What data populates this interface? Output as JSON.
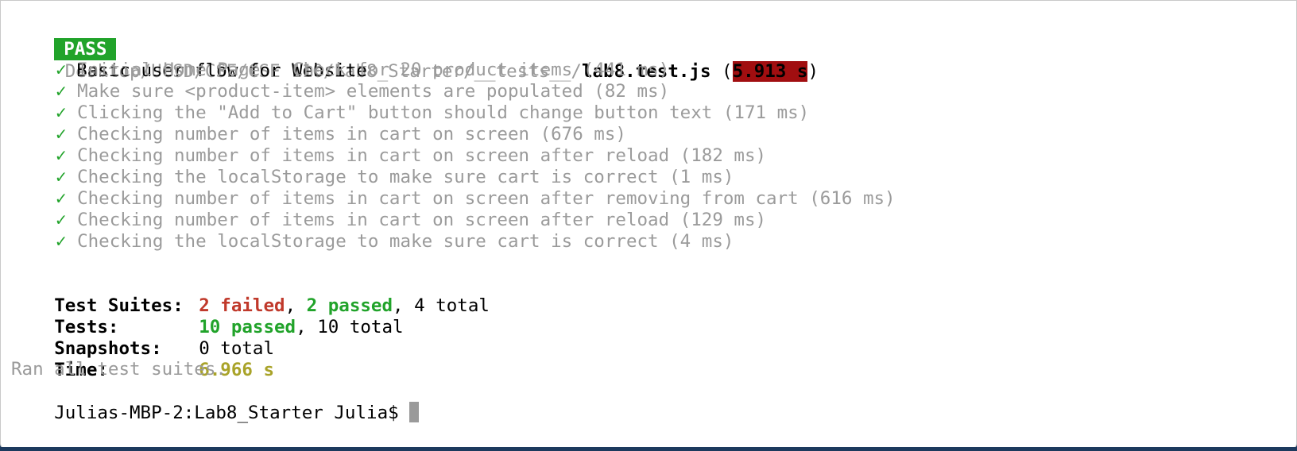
{
  "suite_header": {
    "badge": "PASS",
    "path": "Desktop/UCSD/CSE/CSE 110/Lab8_Starter/__tests__/",
    "file": "lab8.test.js",
    "open_paren": " (",
    "duration": "5.913 s",
    "close_paren": ")"
  },
  "describe_title": "Basic user flow for Website",
  "check_glyph": "✓",
  "tests": [
    "Initial Home Page - Check for 20 product items (441 ms)",
    "Make sure <product-item> elements are populated (82 ms)",
    "Clicking the \"Add to Cart\" button should change button text (171 ms)",
    "Checking number of items in cart on screen (676 ms)",
    "Checking number of items in cart on screen after reload (182 ms)",
    "Checking the localStorage to make sure cart is correct (1 ms)",
    "Checking number of items in cart on screen after removing from cart (616 ms)",
    "Checking number of items in cart on screen after reload (129 ms)",
    "Checking the localStorage to make sure cart is correct (4 ms)"
  ],
  "summary": {
    "suites_label": "Test Suites:",
    "suites_failed": "2 failed",
    "suites_passed": "2 passed",
    "suites_total": "4 total",
    "tests_label": "Tests:",
    "tests_passed": "10 passed",
    "tests_total": "10 total",
    "snapshots_label": "Snapshots:",
    "snapshots_total": "0 total",
    "time_label": "Time:",
    "time_value": "6.966 s",
    "ran_all": "Ran all test suites."
  },
  "prompt": {
    "text": "Julias-MBP-2:Lab8_Starter Julia$ "
  },
  "colors": {
    "pass_badge": "#21a32a",
    "slow_time_badge": "#a10e10",
    "failed_text": "#c0392b",
    "passed_text": "#21a32a",
    "time_text": "#a9a329",
    "dim_text": "#9b9b9b"
  }
}
